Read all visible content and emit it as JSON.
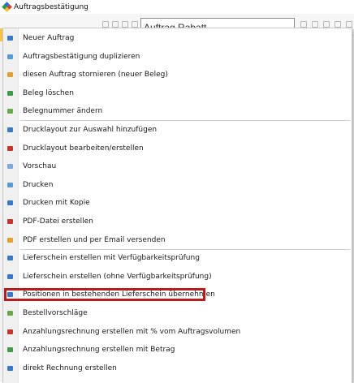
{
  "window": {
    "title": "Auftragsbestätigung",
    "background_field_text": "Auftrag Rabatt"
  },
  "menu": {
    "items": [
      {
        "label": "Neuer Auftrag",
        "icon": "new-order-icon",
        "icon_color": "#3c78c8"
      },
      {
        "label": "Auftragsbestätigung duplizieren",
        "icon": "duplicate-icon",
        "icon_color": "#5b9bd5"
      },
      {
        "label": "diesen Auftrag stornieren (neuer Beleg)",
        "icon": "cancel-document-icon",
        "icon_color": "#e0a030"
      },
      {
        "label": "Beleg löschen",
        "icon": "delete-document-icon",
        "icon_color": "#3f9a4a"
      },
      {
        "label": "Belegnummer ändern",
        "icon": "edit-number-icon",
        "icon_color": "#6aa84f"
      },
      {
        "label": "Drucklayout zur Auswahl hinzufügen",
        "icon": "add-layout-icon",
        "icon_color": "#3c78c8"
      },
      {
        "label": "Drucklayout bearbeiten/erstellen",
        "icon": "edit-layout-icon",
        "icon_color": "#c0392b"
      },
      {
        "label": "Vorschau",
        "icon": "preview-icon",
        "icon_color": "#7fa7d9"
      },
      {
        "label": "Drucken",
        "icon": "print-icon",
        "icon_color": "#5b9bd5"
      },
      {
        "label": "Drucken mit Kopie",
        "icon": "print-copy-icon",
        "icon_color": "#3c78c8"
      },
      {
        "label": "PDF-Datei erstellen",
        "icon": "pdf-icon",
        "icon_color": "#c0392b"
      },
      {
        "label": "PDF erstellen und per Email versenden",
        "icon": "pdf-email-icon",
        "icon_color": "#e0a030"
      },
      {
        "label": "Lieferschein erstellen mit Verfügbarkeitsprüfung",
        "icon": "delivery-note-check-icon",
        "icon_color": "#3c78c8"
      },
      {
        "label": "Lieferschein erstellen (ohne Verfügbarkeitsprüfung)",
        "icon": "delivery-note-icon",
        "icon_color": "#3c78c8"
      },
      {
        "label": "Positionen in bestehenden Lieferschein übernehmen",
        "icon": "transfer-positions-icon",
        "icon_color": "#3c78c8"
      },
      {
        "label": "Bestellvorschläge",
        "icon": "order-suggestions-icon",
        "icon_color": "#6aa84f"
      },
      {
        "label": "Anzahlungsrechnung erstellen mit % vom Auftragsvolumen",
        "icon": "down-payment-percent-icon",
        "icon_color": "#c0392b"
      },
      {
        "label": "Anzahlungsrechnung erstellen mit Betrag",
        "icon": "down-payment-amount-icon",
        "icon_color": "#3f9a4a"
      },
      {
        "label": "direkt Rechnung erstellen",
        "icon": "direct-invoice-icon",
        "icon_color": "#3c78c8"
      }
    ],
    "highlighted_item_index": 14
  }
}
